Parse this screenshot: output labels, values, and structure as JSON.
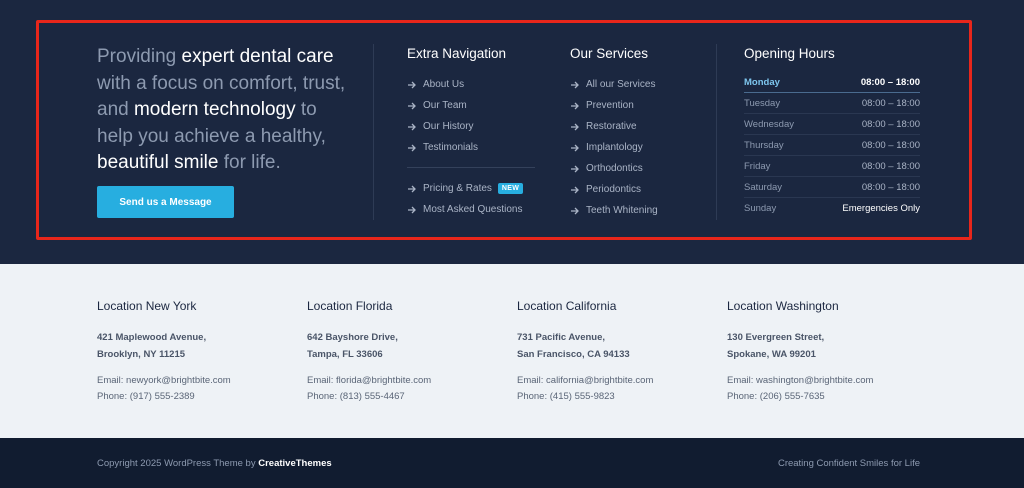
{
  "hero": {
    "part1": "Providing ",
    "hl1": "expert dental care",
    "part2": " with a focus on comfort, trust, and ",
    "hl2": "modern technology",
    "part3": " to help you achieve a healthy, ",
    "hl3": "beautiful smile",
    "part4": " for life.",
    "cta_label": "Send us a Message"
  },
  "extra_nav": {
    "title": "Extra Navigation",
    "items_top": [
      "About Us",
      "Our Team",
      "Our History",
      "Testimonials"
    ],
    "items_bottom": [
      "Pricing & Rates",
      "Most Asked Questions"
    ],
    "badge": "NEW"
  },
  "services": {
    "title": "Our Services",
    "items": [
      "All our Services",
      "Prevention",
      "Restorative",
      "Implantology",
      "Orthodontics",
      "Periodontics",
      "Teeth Whitening"
    ]
  },
  "hours": {
    "title": "Opening Hours",
    "rows": [
      {
        "day": "Monday",
        "time": "08:00 – 18:00"
      },
      {
        "day": "Tuesday",
        "time": "08:00 – 18:00"
      },
      {
        "day": "Wednesday",
        "time": "08:00 – 18:00"
      },
      {
        "day": "Thursday",
        "time": "08:00 – 18:00"
      },
      {
        "day": "Friday",
        "time": "08:00 – 18:00"
      },
      {
        "day": "Saturday",
        "time": "08:00 – 18:00"
      },
      {
        "day": "Sunday",
        "time": "Emergencies Only"
      }
    ]
  },
  "locations": [
    {
      "title": "Location New York",
      "addr1": "421 Maplewood Avenue,",
      "addr2": "Brooklyn, NY 11215",
      "email": "Email: newyork@brightbite.com",
      "phone": "Phone: (917) 555-2389"
    },
    {
      "title": "Location Florida",
      "addr1": "642 Bayshore Drive,",
      "addr2": "Tampa, FL 33606",
      "email": "Email: florida@brightbite.com",
      "phone": "Phone: (813) 555-4467"
    },
    {
      "title": "Location California",
      "addr1": "731 Pacific Avenue,",
      "addr2": "San Francisco, CA 94133",
      "email": "Email: california@brightbite.com",
      "phone": "Phone: (415) 555-9823"
    },
    {
      "title": "Location Washington",
      "addr1": "130 Evergreen Street,",
      "addr2": "Spokane, WA 99201",
      "email": "Email: washington@brightbite.com",
      "phone": "Phone: (206) 555-7635"
    }
  ],
  "footer": {
    "copyright_prefix": "Copyright 2025 WordPress Theme by ",
    "copyright_brand": "CreativeThemes",
    "tagline": "Creating Confident Smiles for Life"
  },
  "colors": {
    "dark_bg": "#1b2740",
    "accent": "#27aee0",
    "highlight_border": "#e8261b",
    "light_bg": "#eef2f6"
  }
}
